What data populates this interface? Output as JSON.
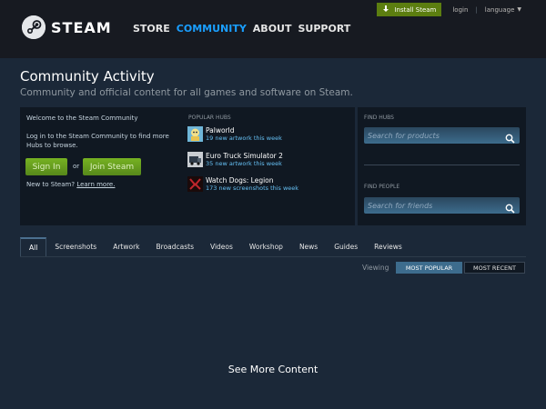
{
  "header": {
    "logo_text": "STEAM",
    "nav": [
      "STORE",
      "COMMUNITY",
      "ABOUT",
      "SUPPORT"
    ],
    "active_nav": "COMMUNITY",
    "install_label": "Install Steam",
    "login_label": "login",
    "separator": "|",
    "language_label": "language"
  },
  "page": {
    "title": "Community Activity",
    "subtitle": "Community and official content for all games and software on Steam."
  },
  "welcome_panel": {
    "welcome": "Welcome to the Steam Community",
    "login_text": "Log in to the Steam Community to find more Hubs to browse.",
    "sign_in_label": "Sign In",
    "or_label": "or",
    "join_label": "Join Steam",
    "new_to_steam": "New to Steam?",
    "learn_more": "Learn more."
  },
  "popular_hubs": {
    "label": "POPULAR HUBS",
    "items": [
      {
        "name": "Palworld",
        "stat": "19 new artwork this week"
      },
      {
        "name": "Euro Truck Simulator 2",
        "stat": "35 new artwork this week"
      },
      {
        "name": "Watch Dogs: Legion",
        "stat": "173 new screenshots this week"
      }
    ]
  },
  "find": {
    "hubs_label": "FIND HUBS",
    "hubs_placeholder": "Search for products",
    "people_label": "FIND PEOPLE",
    "people_placeholder": "Search for friends"
  },
  "tabs": [
    "All",
    "Screenshots",
    "Artwork",
    "Broadcasts",
    "Videos",
    "Workshop",
    "News",
    "Guides",
    "Reviews"
  ],
  "active_tab": "All",
  "viewing": {
    "label": "Viewing",
    "most_popular": "MOST POPULAR",
    "most_recent": "MOST RECENT"
  },
  "see_more": "See More Content",
  "colors": {
    "background": "#1b2838",
    "header": "#171a21",
    "accent_blue": "#1a9fff",
    "link_blue": "#66c0f4",
    "button_green": "#5c7e10"
  },
  "icons": {
    "logo": "steam-logo-icon",
    "install": "download-icon",
    "search": "search-icon",
    "caret": "caret-down-icon"
  }
}
